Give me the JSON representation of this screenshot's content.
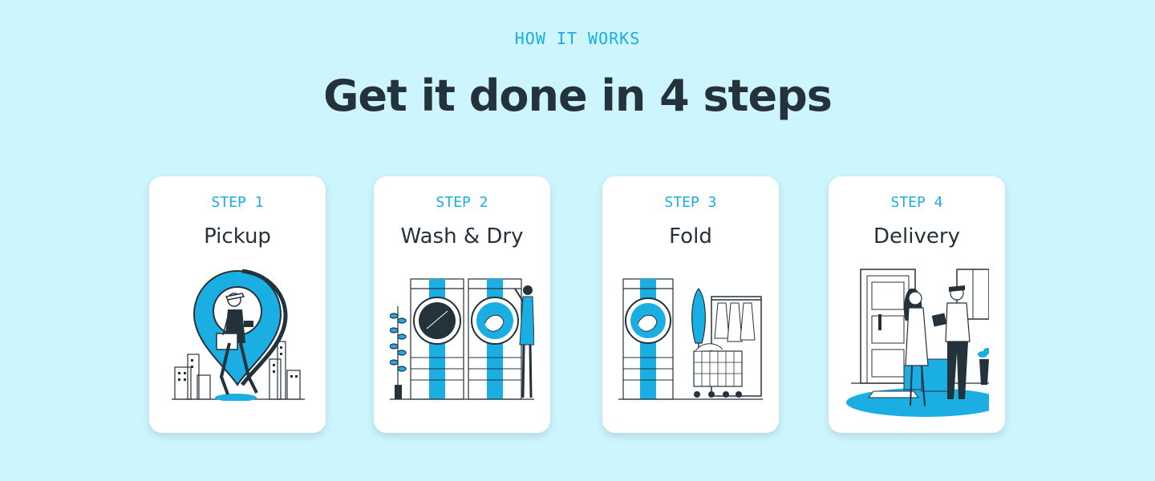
{
  "section": {
    "eyebrow": "HOW IT WORKS",
    "headline": "Get it done in 4 steps"
  },
  "colors": {
    "background": "#cdf5fd",
    "accent": "#1aaee3",
    "heading": "#24323c",
    "card": "#ffffff"
  },
  "steps": [
    {
      "label": "STEP 1",
      "title": "Pickup",
      "illustration": "courier-location-pin-icon"
    },
    {
      "label": "STEP 2",
      "title": "Wash & Dry",
      "illustration": "washing-machines-icon"
    },
    {
      "label": "STEP 3",
      "title": "Fold",
      "illustration": "folded-clothes-rack-icon"
    },
    {
      "label": "STEP 4",
      "title": "Delivery",
      "illustration": "doorstep-delivery-icon"
    }
  ]
}
